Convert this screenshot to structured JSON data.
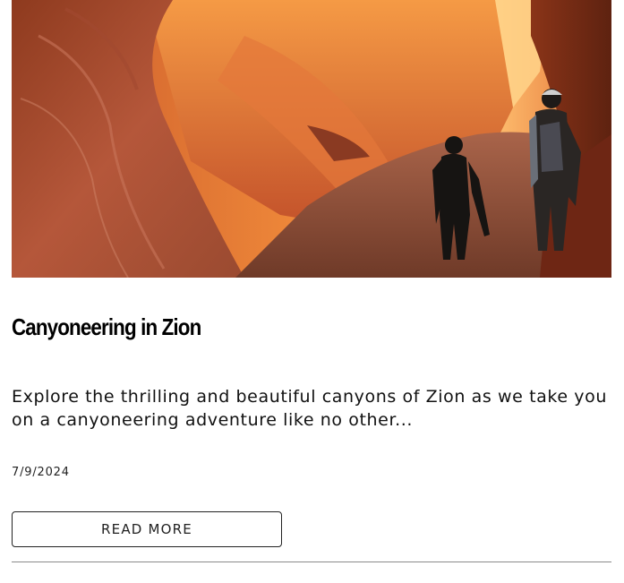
{
  "post": {
    "image_alt": "Two hikers walking through a narrow red-orange slot canyon",
    "title": "Canyoneering in Zion",
    "excerpt": "Explore the thrilling and beautiful canyons of Zion as we take you on a canyoneering adventure like no other...",
    "date": "7/9/2024",
    "read_more_label": "READ MORE"
  },
  "colors": {
    "canyon_light": "#f7a040",
    "canyon_mid": "#d4622a",
    "canyon_dark": "#7a2e14",
    "text": "#111111",
    "button_border": "#222222",
    "divider": "#8a8a8a"
  }
}
